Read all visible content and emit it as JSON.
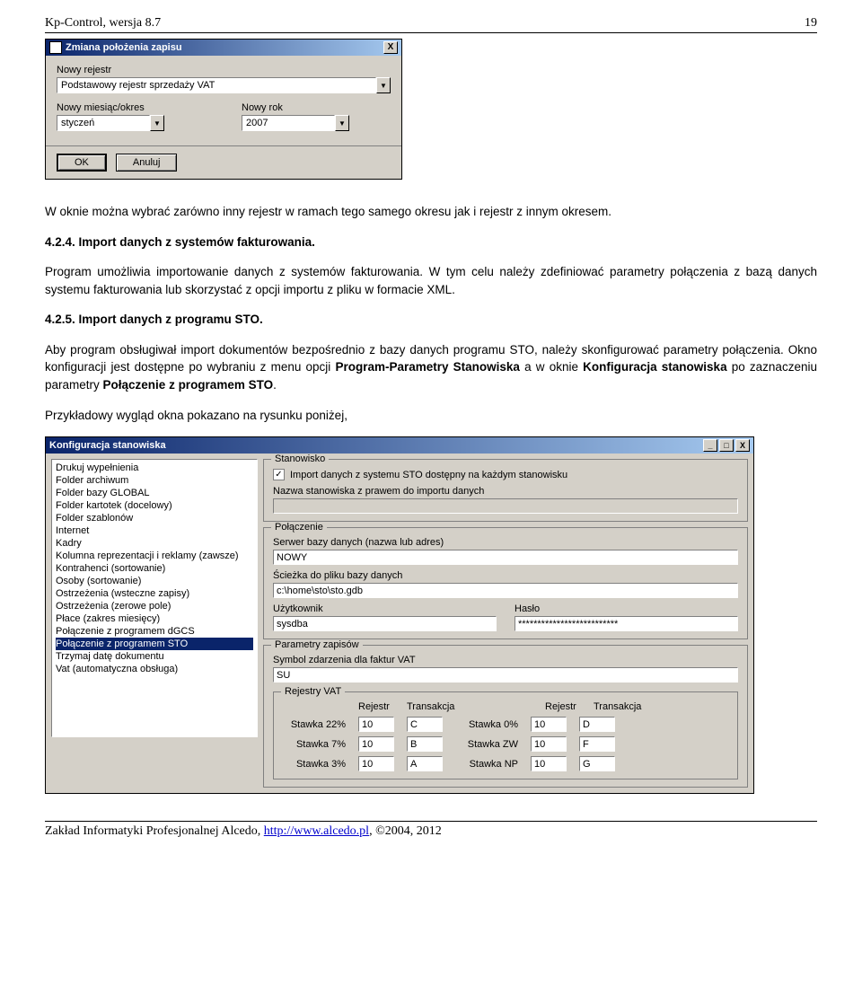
{
  "header": {
    "title": "Kp-Control, wersja 8.7",
    "page": "19"
  },
  "dialog1": {
    "title": "Zmiana położenia zapisu",
    "close": "X",
    "label_registry": "Nowy rejestr",
    "value_registry": "Podstawowy rejestr sprzedaży VAT",
    "label_month": "Nowy miesiąc/okres",
    "value_month": "styczeń",
    "label_year": "Nowy rok",
    "value_year": "2007",
    "ok": "OK",
    "cancel": "Anuluj"
  },
  "body": {
    "p1": "W oknie można wybrać zarówno inny rejestr w ramach tego samego okresu jak i rejestr z innym okresem.",
    "h424": "4.2.4. Import danych z systemów fakturowania.",
    "p2": "Program umożliwia importowanie danych z systemów fakturowania. W tym celu należy zdefiniować parametry połączenia z bazą danych systemu fakturowania lub skorzystać z opcji importu z pliku w formacie XML.",
    "h425": "4.2.5. Import danych z programu STO.",
    "p3a": "Aby program obsługiwał import dokumentów bezpośrednio z bazy danych programu STO, należy skonfigurować parametry połączenia. Okno konfiguracji jest dostępne po wybraniu z menu opcji ",
    "p3b": "Program-Parametry Stanowiska",
    "p3c": " a w oknie ",
    "p3d": "Konfiguracja stanowiska",
    "p3e": " po zaznaczeniu parametry ",
    "p3f": "Połączenie z programem STO",
    "p3g": ".",
    "p4": "Przykładowy wygląd okna pokazano na rysunku poniżej,"
  },
  "dialog2": {
    "title": "Konfiguracja stanowiska",
    "list": [
      "Drukuj wypełnienia",
      "Folder archiwum",
      "Folder bazy GLOBAL",
      "Folder kartotek (docelowy)",
      "Folder szablonów",
      "Internet",
      "Kadry",
      "Kolumna reprezentacji i reklamy (zawsze)",
      "Kontrahenci (sortowanie)",
      "Osoby (sortowanie)",
      "Ostrzeżenia (wsteczne zapisy)",
      "Ostrzeżenia (zerowe pole)",
      "Płace (zakres miesięcy)",
      "Połączenie z programem dGCS",
      "Połączenie z programem STO",
      "Trzymaj datę dokumentu",
      "Vat (automatyczna obsługa)"
    ],
    "selected_index": 14,
    "grp_stan": "Stanowisko",
    "chk_label": "Import danych z systemu STO dostępny na każdym stanowisku",
    "lbl_nazwa": "Nazwa stanowiska z prawem do importu danych",
    "val_nazwa": "",
    "grp_pol": "Połączenie",
    "lbl_server": "Serwer bazy danych (nazwa lub adres)",
    "val_server": "NOWY",
    "lbl_path": "Ścieżka do pliku bazy danych",
    "val_path": "c:\\home\\sto\\sto.gdb",
    "lbl_user": "Użytkownik",
    "val_user": "sysdba",
    "lbl_pass": "Hasło",
    "val_pass": "**************************",
    "grp_param": "Parametry zapisów",
    "lbl_symbol": "Symbol zdarzenia dla faktur VAT",
    "val_symbol": "SU",
    "grp_rejestry": "Rejestry VAT",
    "hdr_rejestr": "Rejestr",
    "hdr_trans": "Transakcja",
    "rows": [
      {
        "l": "Stawka 22%",
        "r1": "10",
        "t1": "C",
        "l2": "Stawka 0%",
        "r2": "10",
        "t2": "D"
      },
      {
        "l": "Stawka 7%",
        "r1": "10",
        "t1": "B",
        "l2": "Stawka ZW",
        "r2": "10",
        "t2": "F"
      },
      {
        "l": "Stawka 3%",
        "r1": "10",
        "t1": "A",
        "l2": "Stawka NP",
        "r2": "10",
        "t2": "G"
      }
    ]
  },
  "footer": {
    "text_pre": "Zakład Informatyki Profesjonalnej Alcedo, ",
    "link": "http://www.alcedo.pl",
    "text_post": ", ©2004, 2012"
  }
}
